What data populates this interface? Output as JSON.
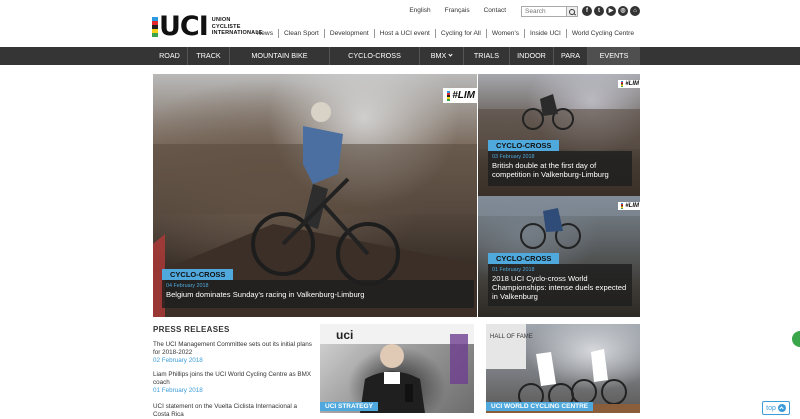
{
  "logo": {
    "letters": "UCI",
    "line1": "UNION",
    "line2": "CYCLISTE",
    "line3": "INTERNATIONALE",
    "stripe_colors": [
      "#2a9be0",
      "#e5252a",
      "#222222",
      "#f7d117",
      "#3ba44a"
    ]
  },
  "topbar": {
    "links": [
      "English",
      "Français",
      "Contact"
    ],
    "search_placeholder": "Search",
    "social_icons": [
      "facebook-icon",
      "twitter-icon",
      "youtube-icon",
      "instagram-icon",
      "cart-icon"
    ]
  },
  "secondary_nav": [
    "News",
    "Clean Sport",
    "Development",
    "Host a UCI event",
    "Cycling for All",
    "Women's",
    "Inside UCI",
    "World Cycling Centre"
  ],
  "main_nav": [
    "ROAD",
    "TRACK",
    "MOUNTAIN BIKE",
    "CYCLO-CROSS",
    "BMX",
    "TRIALS",
    "INDOOR",
    "PARA",
    "EVENTS"
  ],
  "hero": {
    "hashtag": "#LIM",
    "main": {
      "category": "CYCLO-CROSS",
      "date": "04 February 2018",
      "headline": "Belgium dominates Sunday's racing in Valkenburg-Limburg"
    },
    "right1": {
      "category": "CYCLO-CROSS",
      "date": "03 February 2018",
      "headline": "British double at the first day of competition in Valkenburg-Limburg"
    },
    "right2": {
      "category": "CYCLO-CROSS",
      "date": "01 February 2018",
      "headline": "2018 UCI Cyclo-cross World Championships: intense duels expected in Valkenburg"
    }
  },
  "press": {
    "title": "PRESS RELEASES",
    "items": [
      {
        "text": "The UCI Management Committee sets out its initial plans for 2018-2022",
        "date": "02 February 2018"
      },
      {
        "text": "Liam Phillips joins the UCI World Cycling Centre as BMX coach",
        "date": "01 February 2018"
      },
      {
        "text": "UCI statement on the Vuelta Ciclista Internacional a Costa Rica",
        "date": ""
      }
    ]
  },
  "bottom_tiles": [
    {
      "label": "UCI STRATEGY",
      "logo_text": "uci"
    },
    {
      "label": "UCI WORLD CYCLING CENTRE",
      "sign_text": "HALL OF FAME"
    }
  ],
  "top_button": "top",
  "colors": {
    "accent": "#4fa9dc",
    "nav_bg": "#353535",
    "date_blue": "#3c9cd8"
  }
}
